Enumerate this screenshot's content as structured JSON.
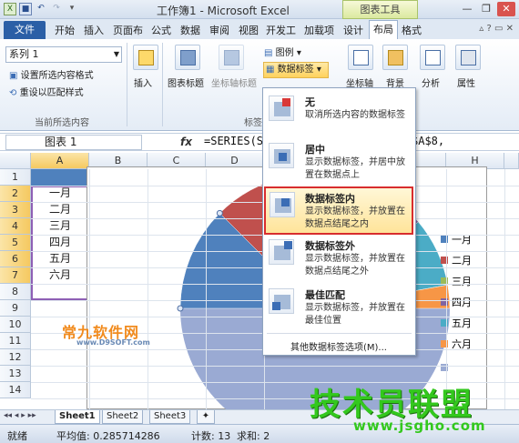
{
  "titlebar": {
    "title": "工作簿1 - Microsoft Excel",
    "chart_tools": "图表工具",
    "minimize": "—",
    "restore": "❐",
    "close": "✕"
  },
  "tabs": {
    "file": "文件",
    "items": [
      "开始",
      "插入",
      "页面布",
      "公式",
      "数据",
      "审阅",
      "视图",
      "开发工",
      "加载项",
      "设计",
      "布局",
      "格式"
    ],
    "active": "布局"
  },
  "ribbon": {
    "series_combo": "系列 1",
    "format_selection": "设置所选内容格式",
    "reset_style": "重设以匹配样式",
    "group_current": "当前所选内容",
    "insert": "插入",
    "chart_title": "图表标题",
    "axis_title": "坐标轴标题",
    "legend": "图例",
    "data_labels": "数据标签",
    "axes": "坐标轴",
    "background": "背景",
    "analysis": "分析",
    "properties": "属性",
    "group_labels": "标签"
  },
  "formula_bar": {
    "name_box": "图表 1",
    "fx": "fx",
    "formula_left": "=SERIES(S",
    "formula_right": "$A$8,"
  },
  "grid": {
    "columns": [
      "A",
      "B",
      "C",
      "D",
      "",
      "",
      "",
      "H"
    ],
    "rows": [
      "1",
      "2",
      "3",
      "4",
      "5",
      "6",
      "7",
      "8",
      "9",
      "10",
      "11",
      "12",
      "13",
      "14"
    ],
    "cells_a": [
      "",
      "一月",
      "二月",
      "三月",
      "四月",
      "五月",
      "六月"
    ]
  },
  "chart_data": {
    "type": "pie",
    "categories": [
      "一月",
      "二月",
      "三月",
      "四月",
      "五月",
      "六月"
    ],
    "legend_placement": "right",
    "slice_colors": [
      "#4f81bd",
      "#c0504d",
      "#9bbb59",
      "#8064a2",
      "#4bacc6",
      "#f79646"
    ]
  },
  "dropdown": {
    "items": [
      {
        "title": "无",
        "desc": "取消所选内容的数据标签"
      },
      {
        "title": "居中",
        "desc": "显示数据标签，并居中放置在数据点上"
      },
      {
        "title": "数据标签内",
        "desc": "显示数据标签，并放置在数据点结尾之内"
      },
      {
        "title": "数据标签外",
        "desc": "显示数据标签，并放置在数据点结尾之外"
      },
      {
        "title": "最佳匹配",
        "desc": "显示数据标签，并放置在最佳位置"
      }
    ],
    "more": "其他数据标签选项(M)..."
  },
  "sheets": [
    "Sheet1",
    "Sheet2",
    "Sheet3"
  ],
  "status": {
    "ready": "就绪",
    "average": "平均值: 0.285714286",
    "count": "计数: 13",
    "sum": "求和: 2"
  },
  "watermarks": {
    "top": "常九软件网",
    "top_url": "www.D9SOFT.com",
    "bottom": "技术员联盟",
    "bottom_url": "www.jsgho.com"
  }
}
